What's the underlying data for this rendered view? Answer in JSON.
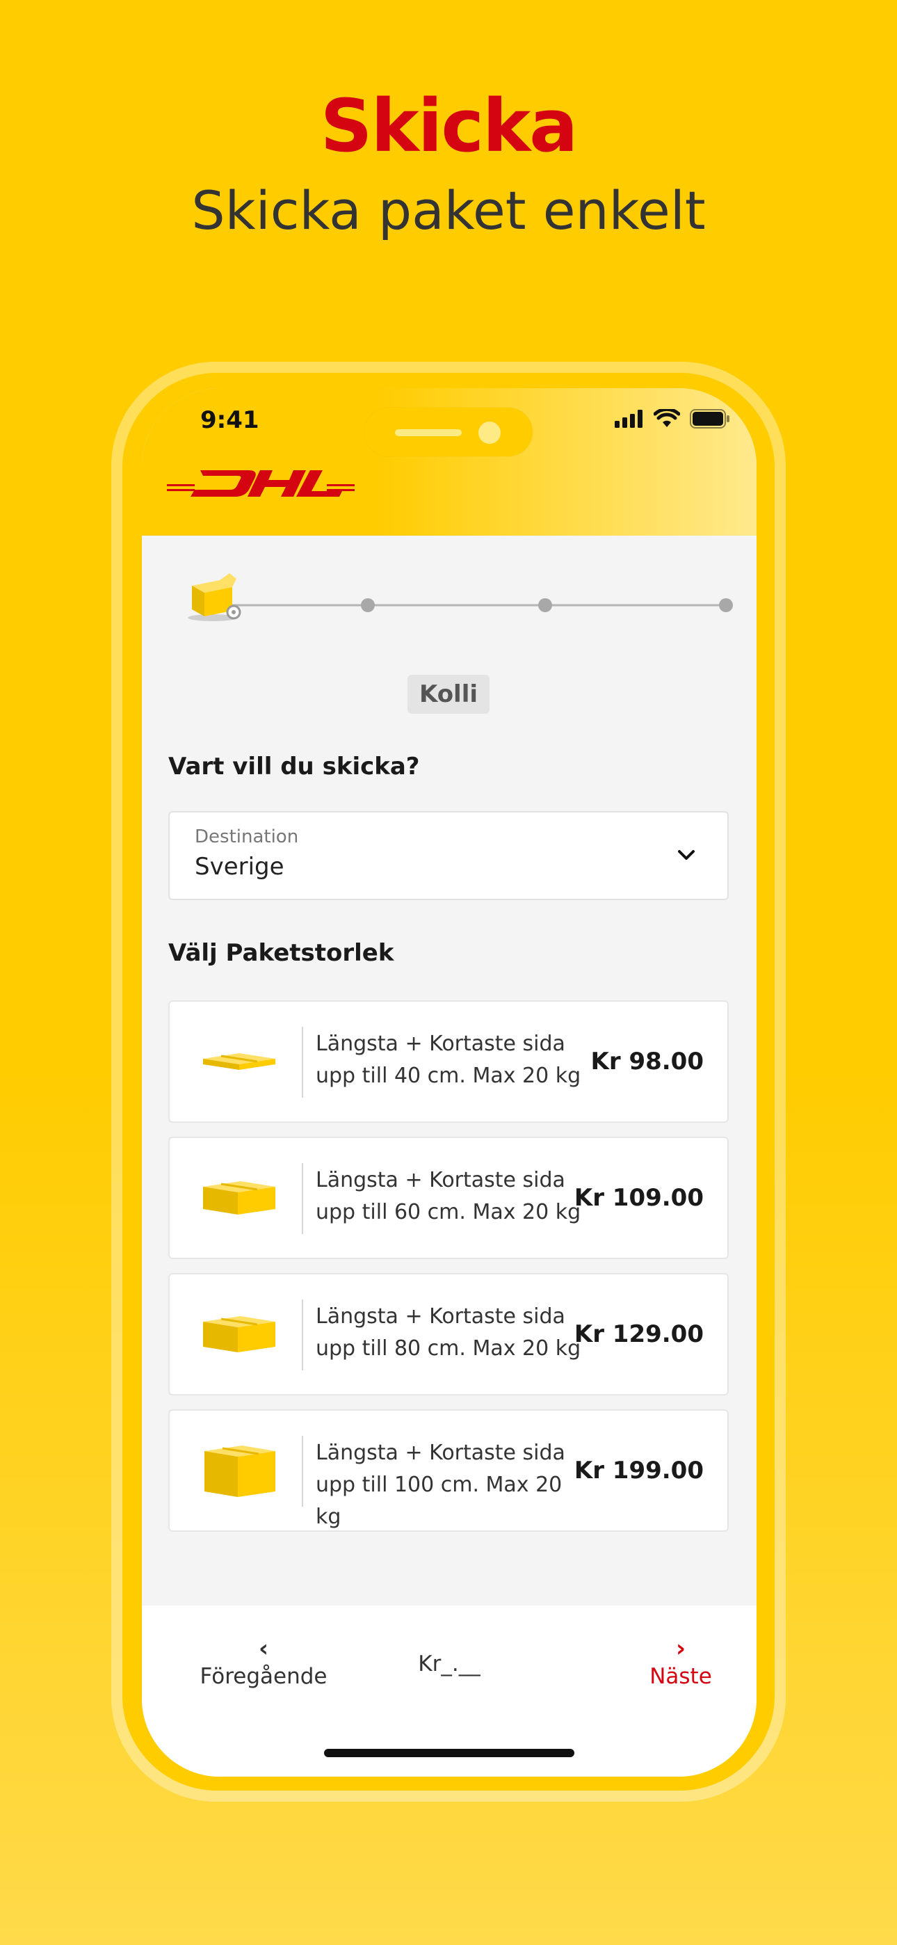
{
  "promo": {
    "title": "Skicka",
    "subtitle": "Skicka paket enkelt"
  },
  "status_bar": {
    "time": "9:41"
  },
  "brand": {
    "logo_text": "DHL",
    "primary_color": "#D40511",
    "accent_color": "#FFCC00"
  },
  "stepper": {
    "steps_total": 4,
    "current_step": 1,
    "current_label": "Kolli"
  },
  "destination_section": {
    "title": "Vart vill du skicka?",
    "field_label": "Destination",
    "field_value": "Sverige"
  },
  "size_section": {
    "title": "Välj Paketstorlek",
    "options": [
      {
        "line1": "Längsta + Kortaste sida",
        "line2": "upp till 40 cm. Max 20 kg",
        "price": "Kr 98.00",
        "icon": "flat-envelope-box-icon"
      },
      {
        "line1": "Längsta + Kortaste sida",
        "line2": "upp till 60 cm. Max 20 kg",
        "price": "Kr 109.00",
        "icon": "small-box-icon"
      },
      {
        "line1": "Längsta + Kortaste sida",
        "line2": "upp till 80 cm. Max 20 kg",
        "price": "Kr 129.00",
        "icon": "medium-box-icon"
      },
      {
        "line1": "Längsta + Kortaste sida",
        "line2": "upp till 100 cm. Max 20 kg",
        "price": "Kr 199.00",
        "icon": "large-box-icon"
      }
    ]
  },
  "bottom_nav": {
    "prev_label": "Föregående",
    "total_label": "Kr_.__",
    "next_label": "Näste"
  }
}
